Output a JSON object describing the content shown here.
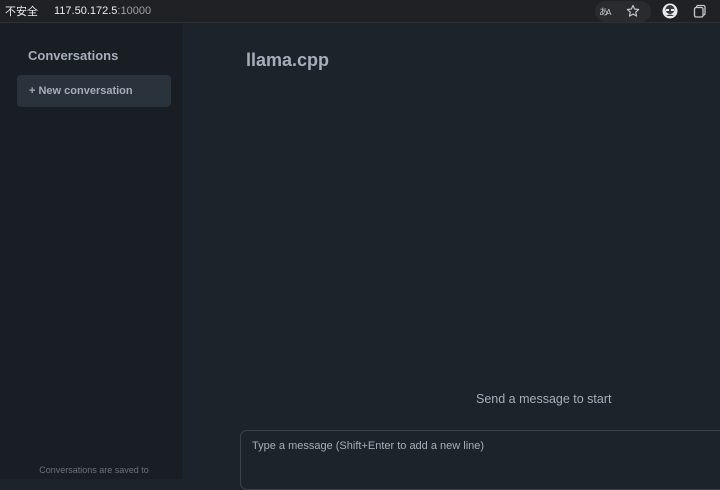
{
  "browser": {
    "security_label": "不安全",
    "url_host": "117.50.172.5",
    "url_port": ":10000",
    "icons": [
      "translate-icon",
      "star-icon",
      "profile-icon",
      "tab-copy-icon"
    ]
  },
  "sidebar": {
    "title": "Conversations",
    "new_conversation_label": "+ New conversation",
    "footer_note": "Conversations are saved to"
  },
  "main": {
    "title": "llama.cpp",
    "empty_hint": "Send a message to start",
    "composer_placeholder": "Type a message (Shift+Enter to add a new line)"
  },
  "colors": {
    "background": "#1d232a",
    "sidebar": "#191e24",
    "button": "#2a323c",
    "text": "#a6adbb"
  }
}
